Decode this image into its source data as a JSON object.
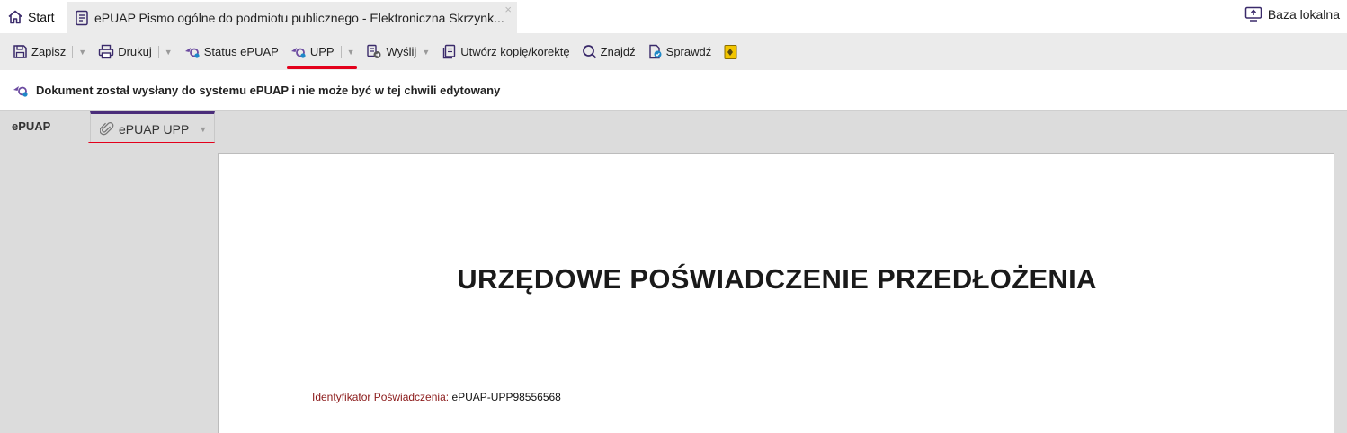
{
  "tabs": {
    "start_label": "Start",
    "doc_title": "ePUAP Pismo ogólne do podmiotu publicznego - Elektroniczna Skrzynk...",
    "close_glyph": "×",
    "baza_label": "Baza lokalna"
  },
  "toolbar": {
    "zapisz": "Zapisz",
    "drukuj": "Drukuj",
    "status": "Status ePUAP",
    "upp": "UPP",
    "wyslij": "Wyślij",
    "kopia": "Utwórz kopię/korektę",
    "znajdz": "Znajdź",
    "sprawdz": "Sprawdź",
    "dropdown_glyph": "▼"
  },
  "notice": {
    "text": "Dokument został wysłany do systemu ePUAP i nie może być w tej chwili edytowany"
  },
  "sections": {
    "epuap_label": "ePUAP",
    "upp_tab_label": "ePUAP UPP",
    "dropdown_glyph": "▼"
  },
  "document": {
    "title": "URZĘDOWE POŚWIADCZENIE PRZEDŁOŻENIA",
    "id_label": "Identyfikator Poświadczenia:",
    "id_value": "ePUAP-UPP98556568"
  },
  "colors": {
    "accent_purple": "#4a2d7a",
    "highlight_red": "#e3001b",
    "label_dark_red": "#8b1a1a"
  }
}
